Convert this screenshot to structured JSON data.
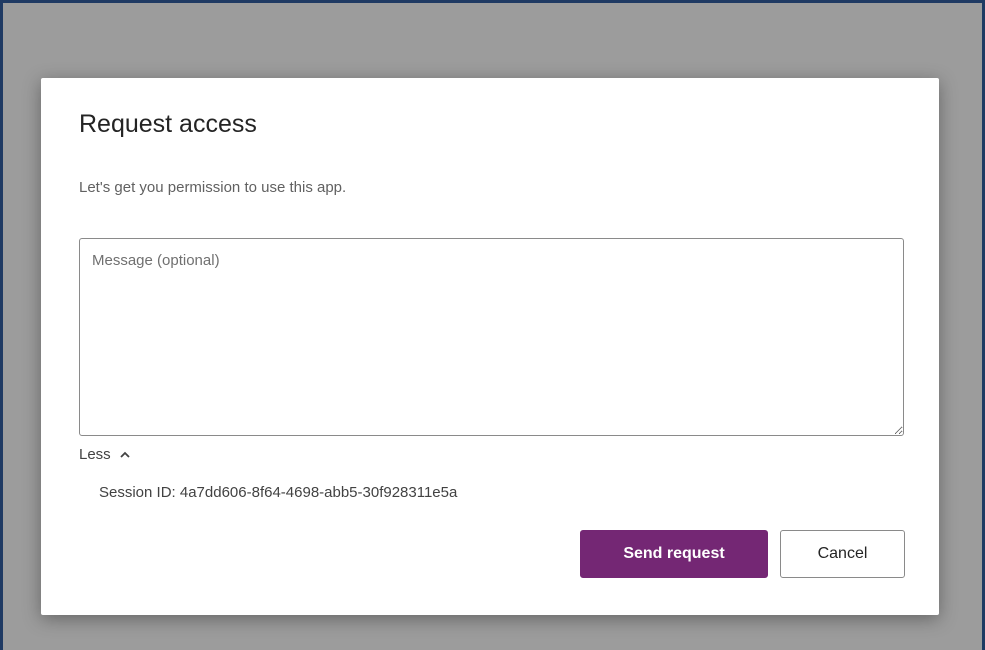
{
  "dialog": {
    "title": "Request access",
    "subtitle": "Let's get you permission to use this app.",
    "message_placeholder": "Message (optional)",
    "message_value": "",
    "details_toggle_label": "Less",
    "session_text": "Session ID: 4a7dd606-8f64-4698-abb5-30f928311e5a",
    "primary_button_label": "Send request",
    "secondary_button_label": "Cancel",
    "toggle_icon": "chevron-up-icon"
  },
  "colors": {
    "primary": "#742774",
    "overlay": "#9c9c9c",
    "frame_border": "#1f3a63"
  }
}
